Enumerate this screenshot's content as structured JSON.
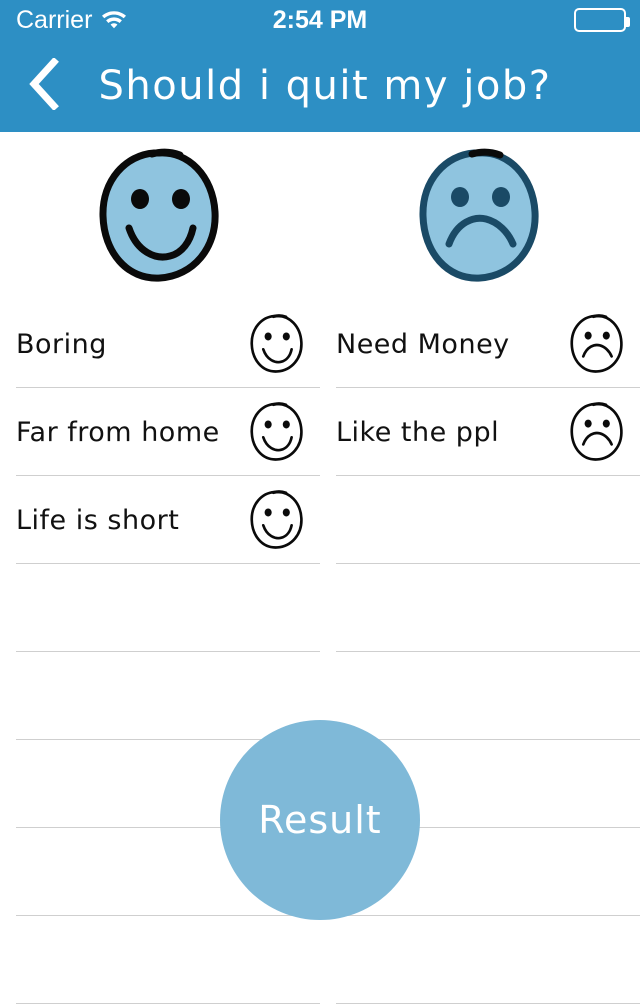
{
  "statusbar": {
    "carrier": "Carrier",
    "wifi_icon": "wifi-icon",
    "time": "2:54 PM",
    "battery_icon": "battery-icon"
  },
  "navbar": {
    "back_icon": "chevron-left-icon",
    "title": "Should i quit my job?"
  },
  "header_faces": {
    "pro_icon": "happy-face-icon",
    "con_icon": "sad-face-icon"
  },
  "colors": {
    "header_blue": "#2D8FC4",
    "face_fill": "#8FC4DF",
    "happy_outline": "#0A0A0A",
    "sad_outline": "#1A4A66",
    "result_button": "#7FB9D8",
    "separator": "#cfcfcf",
    "text": "#111111"
  },
  "lists": {
    "left_column": {
      "rows": [
        {
          "label": "Boring",
          "icon": "happy-face-icon",
          "has_icon": true
        },
        {
          "label": "Far from home",
          "icon": "happy-face-icon",
          "has_icon": true
        },
        {
          "label": "Life is short",
          "icon": "happy-face-icon",
          "has_icon": true
        },
        {
          "label": "",
          "icon": "",
          "has_icon": false
        },
        {
          "label": "",
          "icon": "",
          "has_icon": false
        },
        {
          "label": "",
          "icon": "",
          "has_icon": false
        },
        {
          "label": "",
          "icon": "",
          "has_icon": false
        },
        {
          "label": "",
          "icon": "",
          "has_icon": false
        }
      ]
    },
    "right_column": {
      "rows": [
        {
          "label": "Need Money",
          "icon": "sad-face-icon",
          "has_icon": true
        },
        {
          "label": "Like the ppl",
          "icon": "sad-face-icon",
          "has_icon": true
        },
        {
          "label": "",
          "icon": "",
          "has_icon": false
        },
        {
          "label": "",
          "icon": "",
          "has_icon": false
        },
        {
          "label": "",
          "icon": "",
          "has_icon": false
        },
        {
          "label": "",
          "icon": "",
          "has_icon": false
        },
        {
          "label": "",
          "icon": "",
          "has_icon": false
        },
        {
          "label": "",
          "icon": "",
          "has_icon": false
        }
      ]
    }
  },
  "result": {
    "label": "Result"
  }
}
